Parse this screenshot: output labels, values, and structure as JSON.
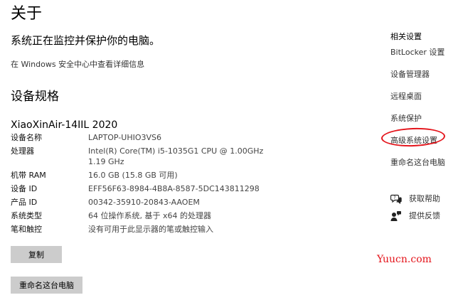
{
  "page": {
    "title": "关于",
    "protect_heading": "系统正在监控并保护你的电脑。",
    "security_link": "在 Windows 安全中心中查看详细信息"
  },
  "specs": {
    "heading": "设备规格",
    "device_name": "XiaoXinAir-14IIL 2020",
    "rows": [
      {
        "key": "设备名称",
        "value": "LAPTOP-UHIO3VS6"
      },
      {
        "key": "处理器",
        "value": "Intel(R) Core(TM) i5-1035G1 CPU @ 1.00GHz   1.19 GHz"
      },
      {
        "key": "机带 RAM",
        "value": "16.0 GB (15.8 GB 可用)"
      },
      {
        "key": "设备 ID",
        "value": "EFF56F63-8984-4B8A-8587-5DC143811298"
      },
      {
        "key": "产品 ID",
        "value": "00342-35910-20843-AAOEM"
      },
      {
        "key": "系统类型",
        "value": "64 位操作系统, 基于 x64 的处理器"
      },
      {
        "key": "笔和触控",
        "value": "没有可用于此显示器的笔或触控输入"
      }
    ],
    "copy_button": "复制",
    "rename_button": "重命名这台电脑"
  },
  "related": {
    "title": "相关设置",
    "links": [
      "BitLocker 设置",
      "设备管理器",
      "远程桌面",
      "系统保护",
      "高级系统设置",
      "重命名这台电脑"
    ],
    "help": [
      {
        "label": "获取帮助",
        "icon": "help-chat-icon"
      },
      {
        "label": "提供反馈",
        "icon": "feedback-person-icon"
      }
    ]
  },
  "annotation": {
    "color": "#e4141b"
  },
  "watermark": {
    "text": "Yuucn.com",
    "color": "#e4141b"
  }
}
